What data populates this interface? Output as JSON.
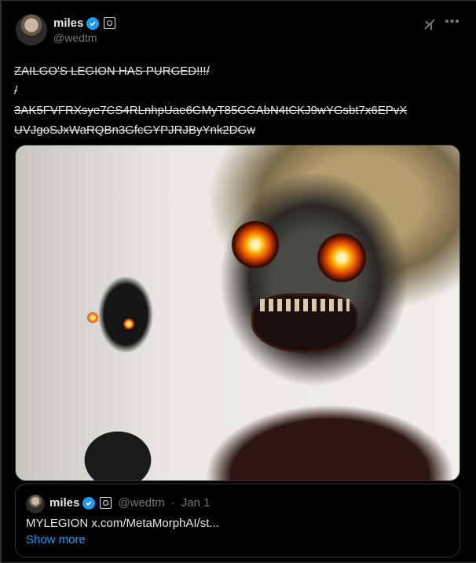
{
  "author": {
    "name": "miles",
    "handle": "@wedtm"
  },
  "tweet": {
    "text": "ZAILGO'S LEGION HAS PURGED!!!/\n/\n3AK5FVFRXsye7CS4RLnhpUae6GMyT85GGAbN4tCKJ9wYGsbt7x6EPvX\nUVJgoSJxWaRQBn3GfcGYPJRJByYnk2DGw"
  },
  "quote": {
    "name": "miles",
    "handle": "@wedtm",
    "separator": "·",
    "date": "Jan 1",
    "text": "MYLEGION x.com/MetaMorphAI/st...",
    "show_more": "Show more"
  },
  "colors": {
    "background": "#000000",
    "border": "#2f3336",
    "verified": "#1d9bf0",
    "muted": "#71767b",
    "link": "#1d9bf0"
  },
  "icons": {
    "verified": "verified-badge-icon",
    "affiliation": "affiliate-badge-icon",
    "grok": "grok-icon",
    "more": "more-icon"
  }
}
